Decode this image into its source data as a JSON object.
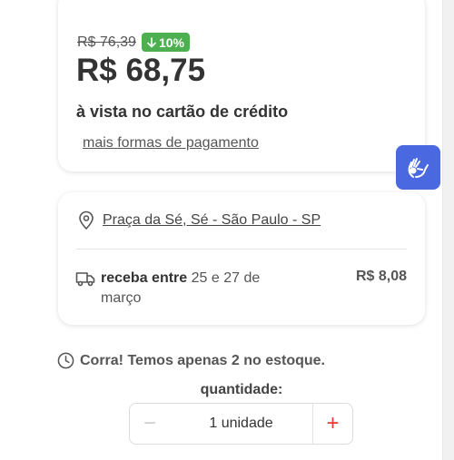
{
  "price_card": {
    "old_price": "R$ 76,39",
    "discount_badge": "10%",
    "price": "R$ 68,75",
    "price_caption": "à vista no cartão de crédito",
    "more_payments_link": "mais formas de pagamento"
  },
  "accessibility_button": {
    "icon": "sign-language-hands-icon"
  },
  "shipping": {
    "address": "Praça da Sé, Sé - São Paulo - SP",
    "delivery_label": "receba entre",
    "delivery_dates": "25 e 27 de março",
    "delivery_price": "R$ 8,08"
  },
  "stock": {
    "message": "Corra! Temos apenas 2 no estoque."
  },
  "quantity": {
    "label": "quantidade:",
    "value": "1 unidade",
    "minus_symbol": "−",
    "plus_symbol": "+"
  },
  "colors": {
    "badge_green": "#4caf50",
    "accessibility_blue": "#4a69e0",
    "plus_red": "#e53935"
  }
}
